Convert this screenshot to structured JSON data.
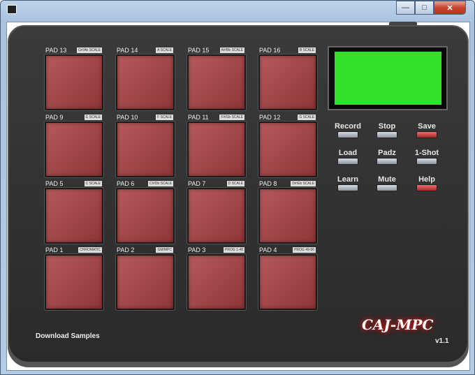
{
  "window": {
    "controls": {
      "minimize": "—",
      "maximize": "□",
      "close": "✕"
    }
  },
  "pads": [
    {
      "label": "PAD 13",
      "scale": "G#/Ab SCALE"
    },
    {
      "label": "PAD 14",
      "scale": "A SCALE"
    },
    {
      "label": "PAD 15",
      "scale": "A#/Bb SCALE"
    },
    {
      "label": "PAD 16",
      "scale": "B SCALE"
    },
    {
      "label": "PAD 9",
      "scale": "E SCALE"
    },
    {
      "label": "PAD 10",
      "scale": "F SCALE"
    },
    {
      "label": "PAD 11",
      "scale": "F#/Gb SCALE"
    },
    {
      "label": "PAD 12",
      "scale": "G SCALE"
    },
    {
      "label": "PAD 5",
      "scale": "C SCALE"
    },
    {
      "label": "PAD 6",
      "scale": "C#/Db SCALE"
    },
    {
      "label": "PAD 7",
      "scale": "D SCALE"
    },
    {
      "label": "PAD 8",
      "scale": "D#/Eb SCALE"
    },
    {
      "label": "PAD 1",
      "scale": "CHROMATIC"
    },
    {
      "label": "PAD 2",
      "scale": "GM/MPC"
    },
    {
      "label": "PAD 3",
      "scale": "PROG 1-48"
    },
    {
      "label": "PAD 4",
      "scale": "PROG 49-96"
    }
  ],
  "buttons": [
    {
      "label": "Record",
      "red": false
    },
    {
      "label": "Stop",
      "red": false
    },
    {
      "label": "Save",
      "red": true
    },
    {
      "label": "Load",
      "red": false
    },
    {
      "label": "Padz",
      "red": false
    },
    {
      "label": "1-Shot",
      "red": false
    },
    {
      "label": "Learn",
      "red": false
    },
    {
      "label": "Mute",
      "red": false
    },
    {
      "label": "Help",
      "red": true
    }
  ],
  "colors": {
    "screen": "#33e02a",
    "pad": "#a04648"
  },
  "download_label": "Download Samples",
  "logo": "CAJ-MPC",
  "version": "v1.1"
}
